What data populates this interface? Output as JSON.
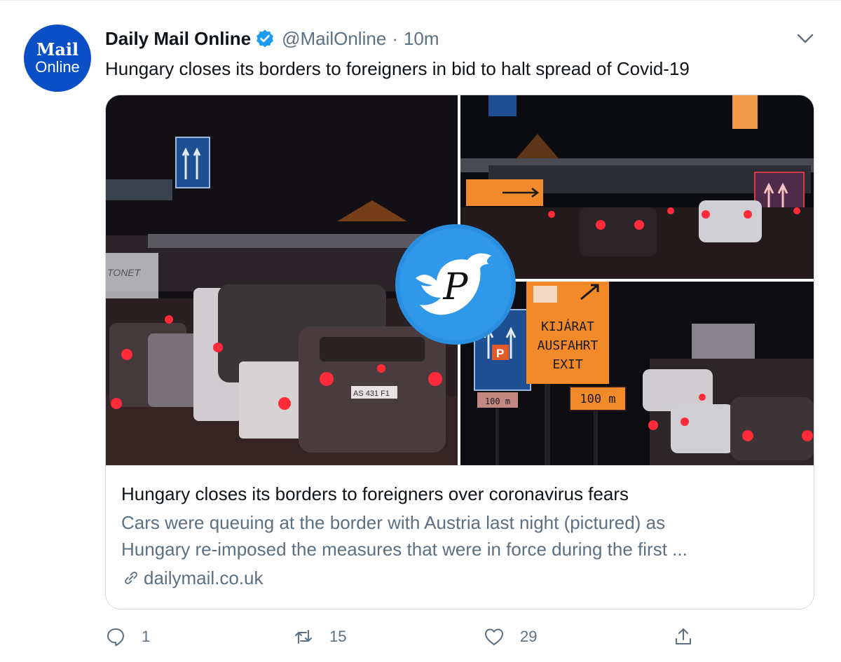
{
  "account": {
    "avatar_line1": "Mail",
    "avatar_line2": "Online",
    "display_name": "Daily Mail Online",
    "handle": "@MailOnline",
    "separator": "·",
    "time": "10m",
    "verified_icon": "verified-badge-icon"
  },
  "tweet": {
    "text": "Hungary closes its borders to foreigners in bid to halt spread of Covid-19"
  },
  "card": {
    "title": "Hungary closes its borders to foreigners over coronavirus fears",
    "description_line1": "Cars were queuing at the border with Austria last night (pictured) as",
    "description_line2": "Hungary re-imposed the measures that were in force during the first ...",
    "domain": "dailymail.co.uk",
    "link_icon": "link-icon"
  },
  "signs": {
    "kijarat": "KIJÁRAT",
    "ausfahrt": "AUSFAHRT",
    "exit": "EXIT",
    "distance": "100 m",
    "distance_small": "100 m",
    "parking": "P",
    "plate": "AS 431 F1",
    "truck_text": "TONET"
  },
  "watermark": {
    "letter": "P"
  },
  "actions": {
    "reply_count": "1",
    "retweet_count": "15",
    "like_count": "29"
  },
  "colors": {
    "avatar_blue": "#0b4fc7",
    "verified_blue": "#1d9bf0",
    "secondary_text": "#5b7083",
    "border": "#cfd9de",
    "sign_orange": "#f28a2a",
    "watermark_blue": "#2a8fe0"
  }
}
